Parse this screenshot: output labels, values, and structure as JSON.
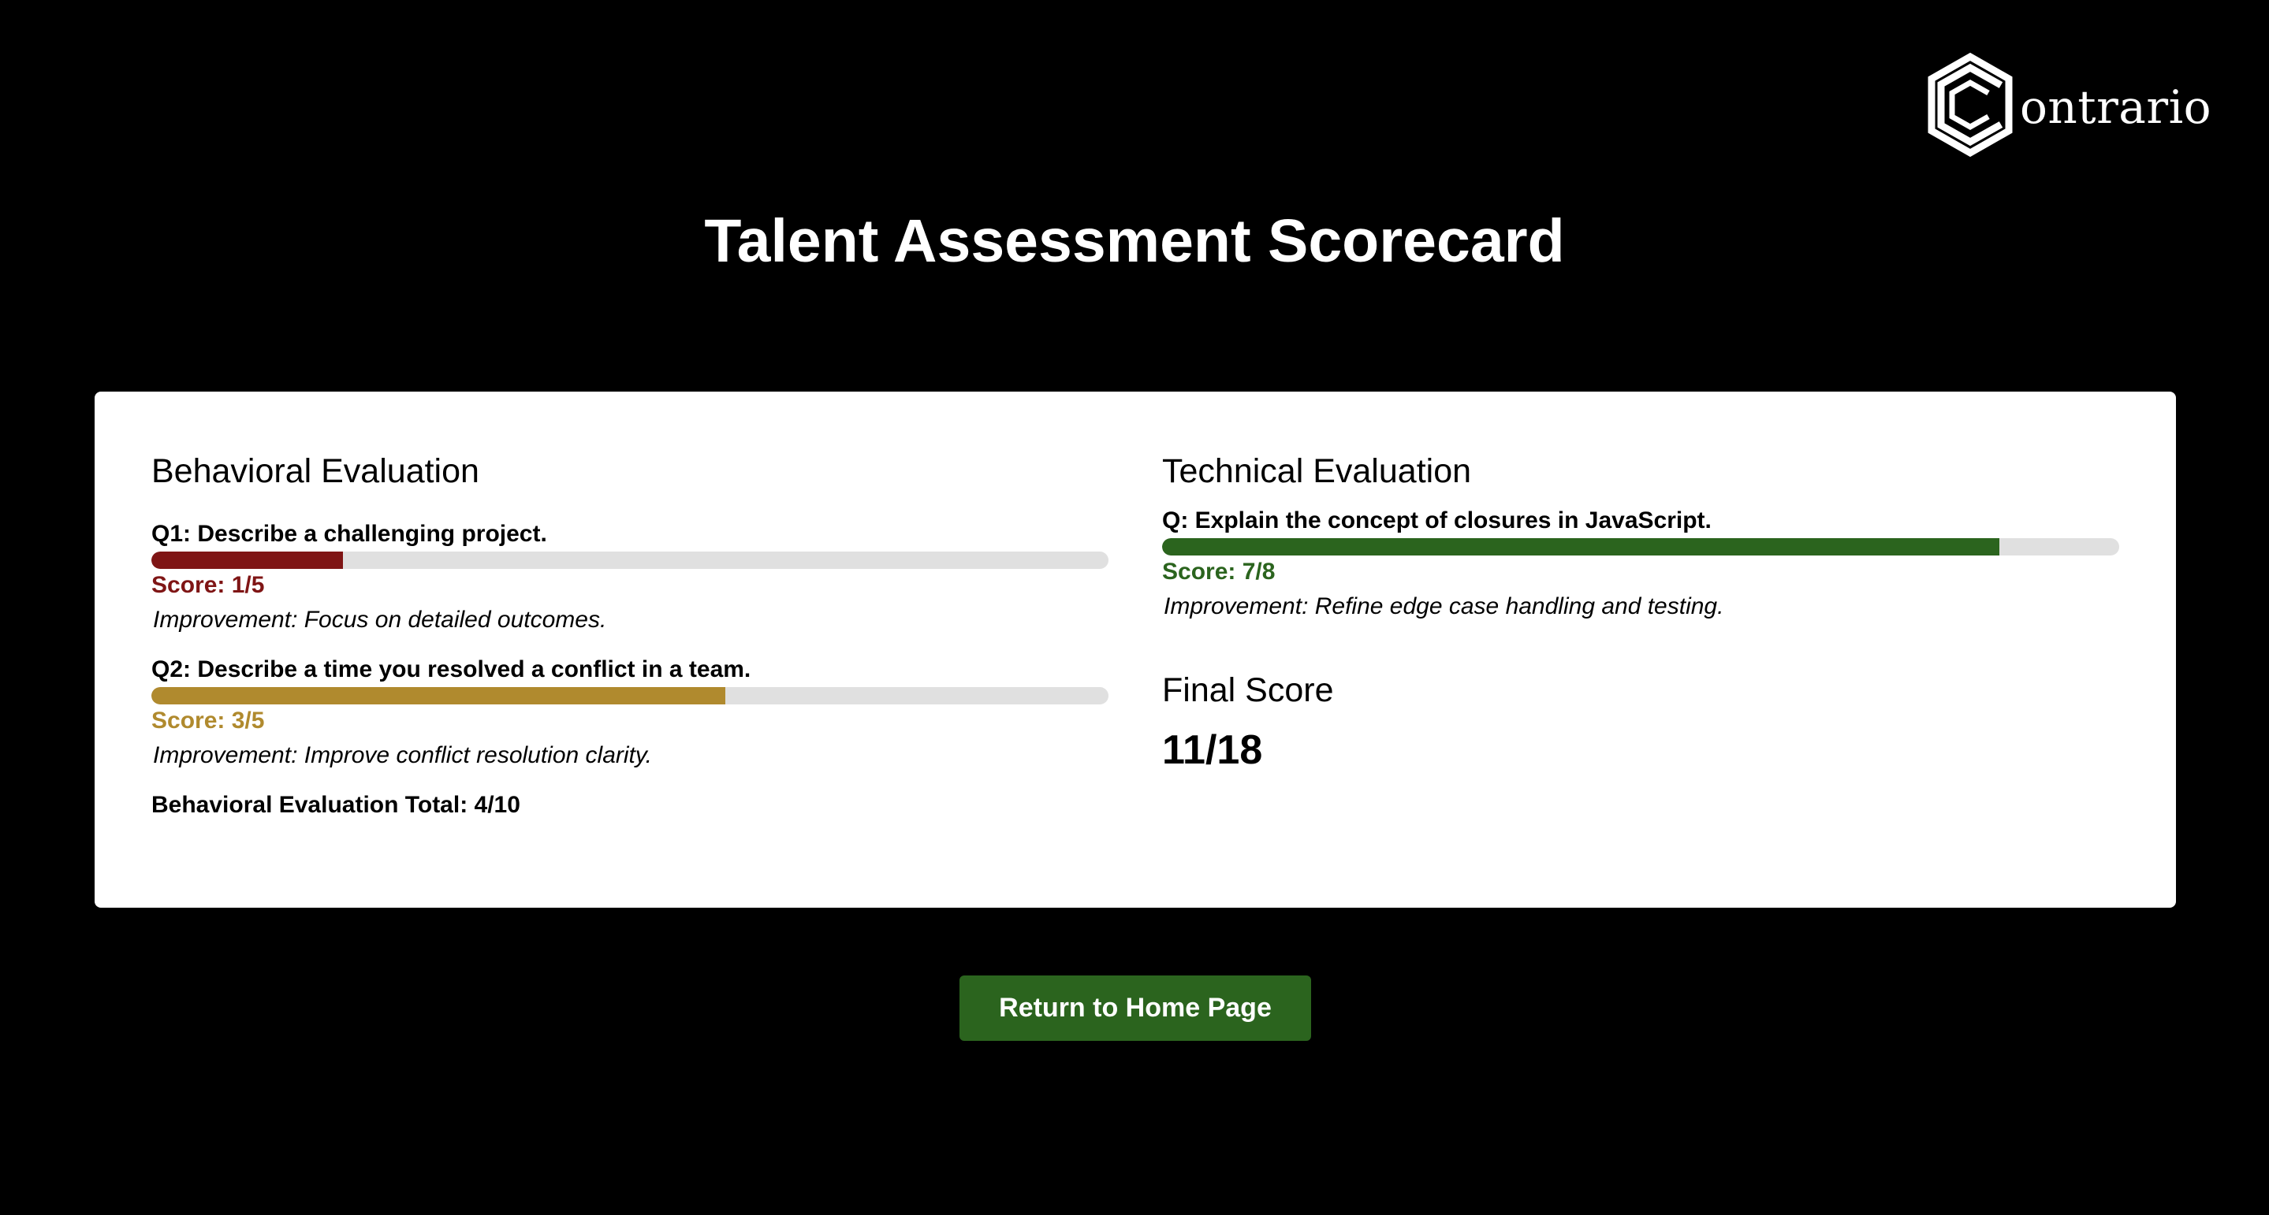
{
  "brand": {
    "logo_text": "ontrario",
    "icon": "hexagon-c-logo-icon"
  },
  "page": {
    "title": "Talent Assessment Scorecard"
  },
  "behavioral": {
    "title": "Behavioral Evaluation",
    "questions": [
      {
        "question": "Q1: Describe a challenging project.",
        "score_text": "Score: 1/5",
        "score": 1,
        "max": 5,
        "progress": 0.2,
        "color": "#7f1515",
        "improvement": "Improvement: Focus on detailed outcomes."
      },
      {
        "question": "Q2: Describe a time you resolved a conflict in a team.",
        "score_text": "Score: 3/5",
        "score": 3,
        "max": 5,
        "progress": 0.6,
        "color": "#b08a2e",
        "improvement": "Improvement: Improve conflict resolution clarity."
      }
    ],
    "total_text": "Behavioral Evaluation Total: 4/10"
  },
  "technical": {
    "title": "Technical Evaluation",
    "question": "Q: Explain the concept of closures in JavaScript.",
    "score_text": "Score: 7/8",
    "score": 7,
    "max": 8,
    "progress": 0.875,
    "color": "#2b641e",
    "improvement": "Improvement: Refine edge case handling and testing."
  },
  "final": {
    "label": "Final Score",
    "value": "11/18"
  },
  "actions": {
    "home_label": "Return to Home Page"
  },
  "colors": {
    "background": "#000000",
    "card": "#ffffff",
    "track": "#e0e0e0",
    "button": "#2b641e"
  }
}
